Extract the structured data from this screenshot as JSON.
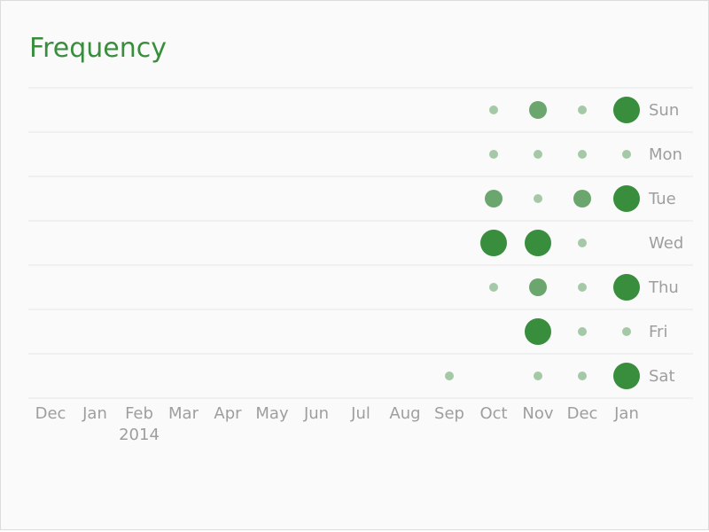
{
  "header": {
    "title": "Frequency"
  },
  "colors": {
    "accent": "#388e3c",
    "light": "#a5c9a7",
    "mid": "#6aa66d",
    "grid": "#e6e6e6",
    "text": "#9e9e9e"
  },
  "chart_data": {
    "type": "scatter",
    "title": "Frequency",
    "xlabel": "",
    "ylabel": "",
    "x_ticks": [
      {
        "label": "Dec",
        "sub": ""
      },
      {
        "label": "Jan",
        "sub": ""
      },
      {
        "label": "Feb",
        "sub": "2014"
      },
      {
        "label": "Mar",
        "sub": ""
      },
      {
        "label": "Apr",
        "sub": ""
      },
      {
        "label": "May",
        "sub": ""
      },
      {
        "label": "Jun",
        "sub": ""
      },
      {
        "label": "Jul",
        "sub": ""
      },
      {
        "label": "Aug",
        "sub": ""
      },
      {
        "label": "Sep",
        "sub": ""
      },
      {
        "label": "Oct",
        "sub": ""
      },
      {
        "label": "Nov",
        "sub": ""
      },
      {
        "label": "Dec",
        "sub": ""
      },
      {
        "label": "Jan",
        "sub": ""
      }
    ],
    "y_categories": [
      "Sun",
      "Mon",
      "Tue",
      "Wed",
      "Thu",
      "Fri",
      "Sat"
    ],
    "size_scale": [
      1,
      2,
      3
    ],
    "points": [
      {
        "month": "Oct",
        "day": "Sun",
        "size": 1
      },
      {
        "month": "Nov",
        "day": "Sun",
        "size": 2
      },
      {
        "month": "Dec",
        "day": "Sun",
        "size": 1
      },
      {
        "month": "Jan",
        "day": "Sun",
        "size": 3
      },
      {
        "month": "Oct",
        "day": "Mon",
        "size": 1
      },
      {
        "month": "Nov",
        "day": "Mon",
        "size": 1
      },
      {
        "month": "Dec",
        "day": "Mon",
        "size": 1
      },
      {
        "month": "Jan",
        "day": "Mon",
        "size": 1
      },
      {
        "month": "Oct",
        "day": "Tue",
        "size": 2
      },
      {
        "month": "Nov",
        "day": "Tue",
        "size": 1
      },
      {
        "month": "Dec",
        "day": "Tue",
        "size": 2
      },
      {
        "month": "Jan",
        "day": "Tue",
        "size": 3
      },
      {
        "month": "Oct",
        "day": "Wed",
        "size": 3
      },
      {
        "month": "Nov",
        "day": "Wed",
        "size": 3
      },
      {
        "month": "Dec",
        "day": "Wed",
        "size": 1
      },
      {
        "month": "Oct",
        "day": "Thu",
        "size": 1
      },
      {
        "month": "Nov",
        "day": "Thu",
        "size": 2
      },
      {
        "month": "Dec",
        "day": "Thu",
        "size": 1
      },
      {
        "month": "Jan",
        "day": "Thu",
        "size": 3
      },
      {
        "month": "Nov",
        "day": "Fri",
        "size": 3
      },
      {
        "month": "Dec",
        "day": "Fri",
        "size": 1
      },
      {
        "month": "Jan",
        "day": "Fri",
        "size": 1
      },
      {
        "month": "Sep",
        "day": "Sat",
        "size": 1
      },
      {
        "month": "Nov",
        "day": "Sat",
        "size": 1
      },
      {
        "month": "Dec",
        "day": "Sat",
        "size": 1
      },
      {
        "month": "Jan",
        "day": "Sat",
        "size": 3
      }
    ],
    "grid": true,
    "legend": "none"
  }
}
